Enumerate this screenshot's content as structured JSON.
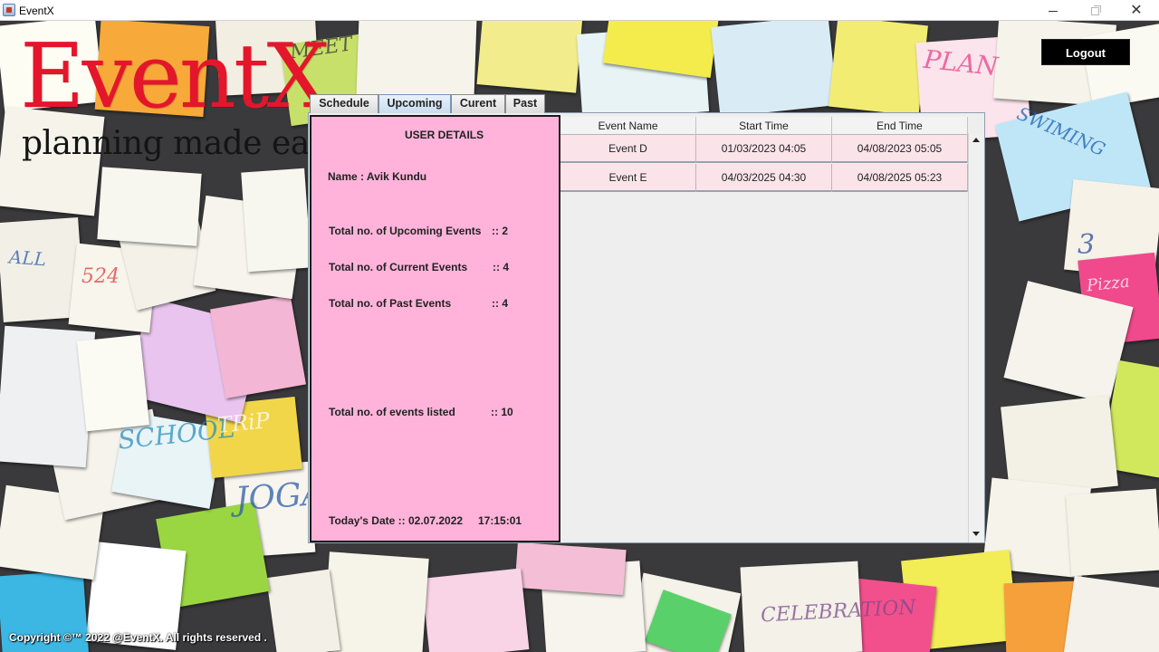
{
  "window": {
    "title": "EventX"
  },
  "brand": {
    "title": "EventX",
    "tagline": "planning made easy"
  },
  "header": {
    "logout_label": "Logout"
  },
  "tabs": [
    {
      "label": "Schedule",
      "active": false
    },
    {
      "label": "Upcoming",
      "active": true
    },
    {
      "label": "Curent",
      "active": false
    },
    {
      "label": "Past",
      "active": false
    }
  ],
  "user_details": {
    "heading": "USER DETAILS",
    "name_label": "Name : Avik  Kundu",
    "upcoming_label": "Total no. of Upcoming Events",
    "upcoming_value": ":: 2",
    "current_label": "Total no. of Current Events",
    "current_value": ":: 4",
    "past_label": "Total no. of Past Events",
    "past_value": ":: 4",
    "listed_label": "Total no. of events listed",
    "listed_value": ":: 10",
    "date_label": "Today's Date :: 02.07.2022",
    "time_value": "17:15:01"
  },
  "table": {
    "columns": [
      "Event Name",
      "Start Time",
      "End Time"
    ],
    "rows": [
      [
        "Event D",
        "01/03/2023  04:05",
        "04/08/2023  05:05"
      ],
      [
        "Event E",
        "04/03/2025  04:30",
        "04/08/2025  05:23"
      ]
    ]
  },
  "footer": {
    "copyright": "Copyright ©™ 2022 @EventX. All rights reserved ."
  },
  "colors": {
    "brand_red": "#e4162b",
    "details_pink": "#ffb3da",
    "row_pink": "#fbe3ea",
    "logout_bg": "#000000"
  }
}
